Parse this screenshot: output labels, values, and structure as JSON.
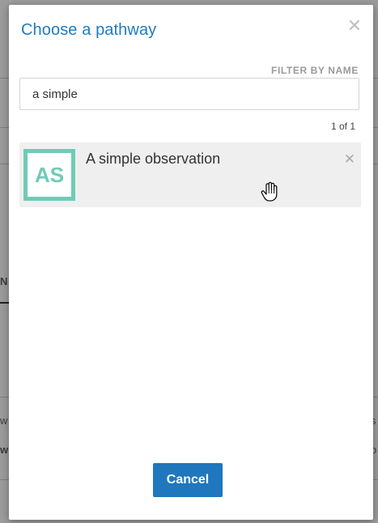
{
  "dialog": {
    "title": "Choose a pathway",
    "close_icon": "close-icon"
  },
  "filter": {
    "label": "FILTER BY NAME",
    "value": "a simple",
    "placeholder": ""
  },
  "results": {
    "count_text": "1 of 1",
    "items": [
      {
        "initials": "AS",
        "name": "A simple observation",
        "badge_color": "#6fcbb8",
        "remove_icon": "close-icon"
      }
    ]
  },
  "footer": {
    "cancel_label": "Cancel"
  },
  "background": {
    "fragment_left": "N",
    "row_left_1": "w",
    "row_left_2": "w",
    "row_right_1": "is",
    "row_right_2": "o"
  },
  "colors": {
    "accent": "#1e7bbf",
    "button": "#1f77bd",
    "badge": "#6fcbb8"
  }
}
